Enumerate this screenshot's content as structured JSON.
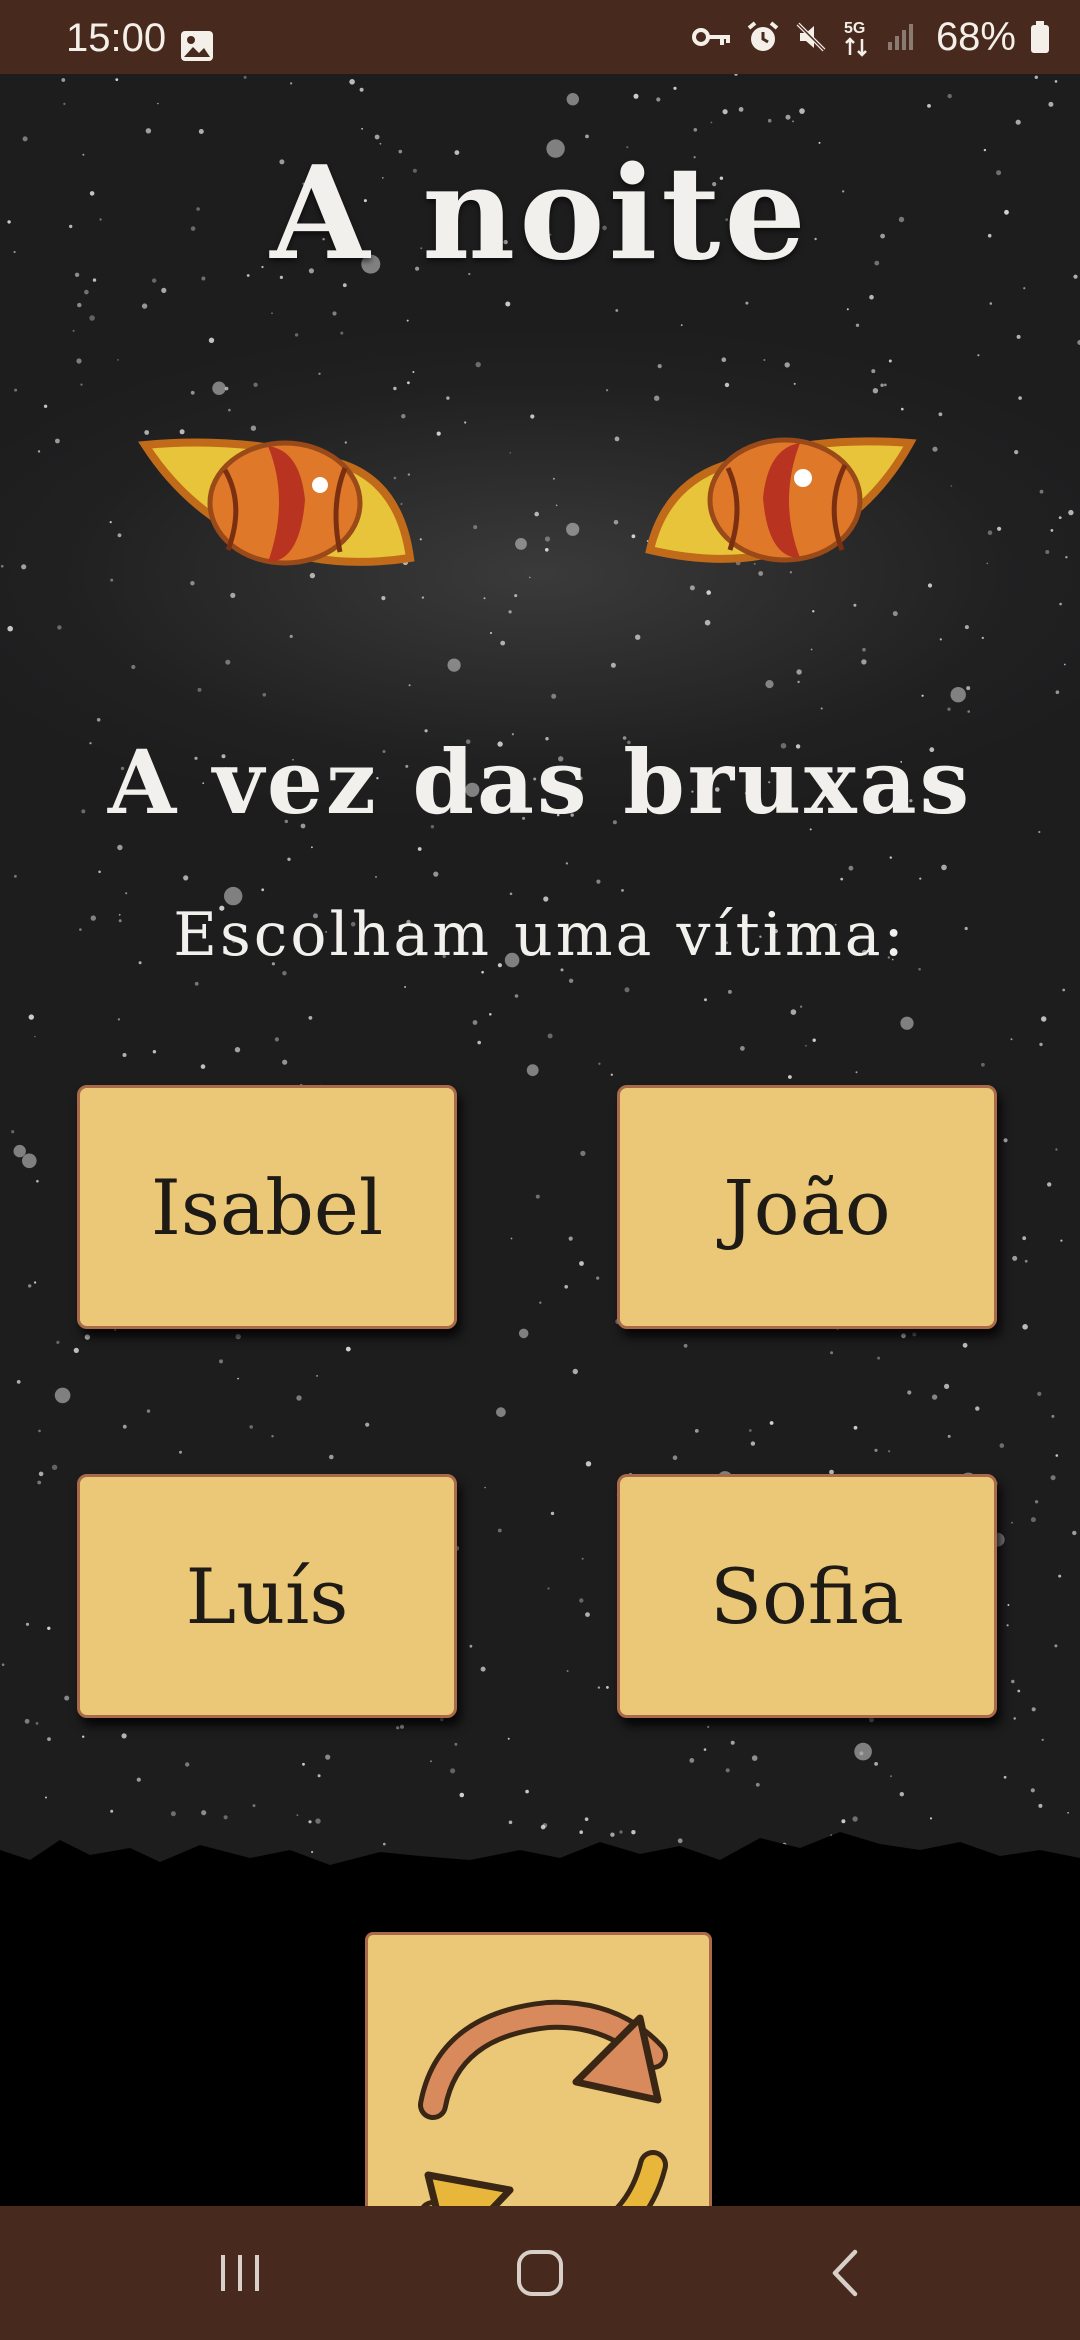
{
  "status_bar": {
    "time": "15:00",
    "network": "5G",
    "battery": "68%",
    "icons": [
      "gallery-icon",
      "vpn-key-icon",
      "alarm-icon",
      "mute-icon",
      "5g-data-icon",
      "signal-icon",
      "battery-icon"
    ]
  },
  "game": {
    "title": "A noite",
    "subtitle": "A vez das bruxas",
    "instruction": "Escolham uma vítima:",
    "players": [
      "Isabel",
      "João",
      "Luís",
      "Sofia"
    ],
    "refresh_icon": "refresh-icon"
  },
  "nav_bar": {
    "icons": [
      "recents-icon",
      "home-icon",
      "back-icon"
    ]
  },
  "colors": {
    "bar": "#472a1d",
    "sky": "#1d1d1e",
    "button": "#ebc778",
    "button_border": "#a86a48",
    "text_light": "#f2f0ec",
    "text_dark": "#1e1a15",
    "eye_outer": "#e8c43a",
    "eye_iris": "#e0782a",
    "eye_pupil": "#b83420"
  }
}
